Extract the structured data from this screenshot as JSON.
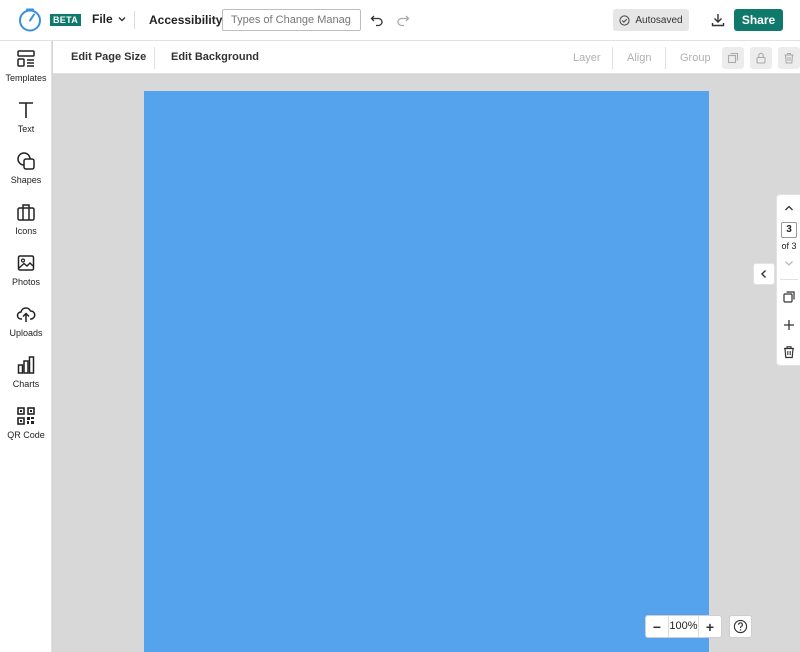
{
  "header": {
    "beta_badge": "BETA",
    "file_label": "File",
    "accessibility_label": "Accessibility",
    "title_placeholder": "Types of Change Manag...",
    "autosaved_label": "Autosaved",
    "share_label": "Share"
  },
  "sidebar": {
    "items": [
      {
        "label": "Templates",
        "icon": "templates-icon"
      },
      {
        "label": "Text",
        "icon": "text-icon"
      },
      {
        "label": "Shapes",
        "icon": "shapes-icon"
      },
      {
        "label": "Icons",
        "icon": "briefcase-icon"
      },
      {
        "label": "Photos",
        "icon": "image-icon"
      },
      {
        "label": "Uploads",
        "icon": "cloud-upload-icon"
      },
      {
        "label": "Charts",
        "icon": "bar-chart-icon"
      },
      {
        "label": "QR Code",
        "icon": "qr-code-icon"
      }
    ]
  },
  "toolbar": {
    "edit_page_size": "Edit Page Size",
    "edit_background": "Edit Background",
    "layer": "Layer",
    "align": "Align",
    "group": "Group"
  },
  "page_nav": {
    "current": "3",
    "of_label": "of 3"
  },
  "zoom": {
    "minus": "−",
    "value": "100%",
    "plus": "+"
  },
  "colors": {
    "brand": "#0f7a6c",
    "page_background": "#54a3ec",
    "logo": "#3b8ede"
  }
}
